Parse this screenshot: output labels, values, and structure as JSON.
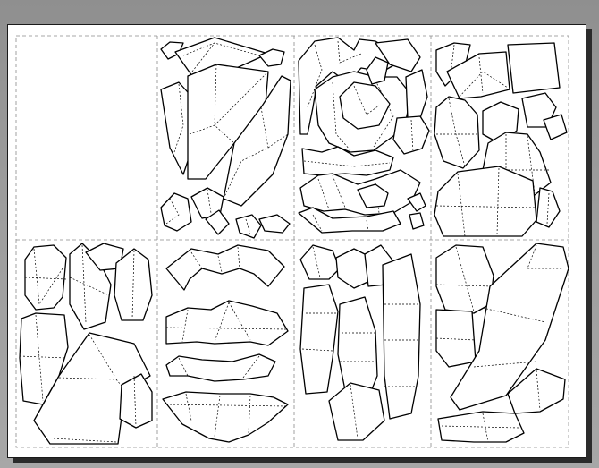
{
  "document": {
    "title": "",
    "type": "papercraft-template-sheet",
    "panels": [
      {
        "id": "r1c1",
        "content": "empty"
      },
      {
        "id": "r1c2",
        "content": "paper-net-parts"
      },
      {
        "id": "r1c3",
        "content": "paper-net-parts"
      },
      {
        "id": "r1c4",
        "content": "paper-net-parts"
      },
      {
        "id": "r2c1",
        "content": "paper-net-parts"
      },
      {
        "id": "r2c2",
        "content": "paper-net-parts"
      },
      {
        "id": "r2c3",
        "content": "paper-net-parts"
      },
      {
        "id": "r2c4",
        "content": "paper-net-parts"
      }
    ]
  },
  "colors": {
    "background": "#9c9c9c",
    "paper": "#ffffff",
    "shadow": "#2b2b2b",
    "cut_line": "#000000",
    "guide_line": "#8a8a8a"
  }
}
